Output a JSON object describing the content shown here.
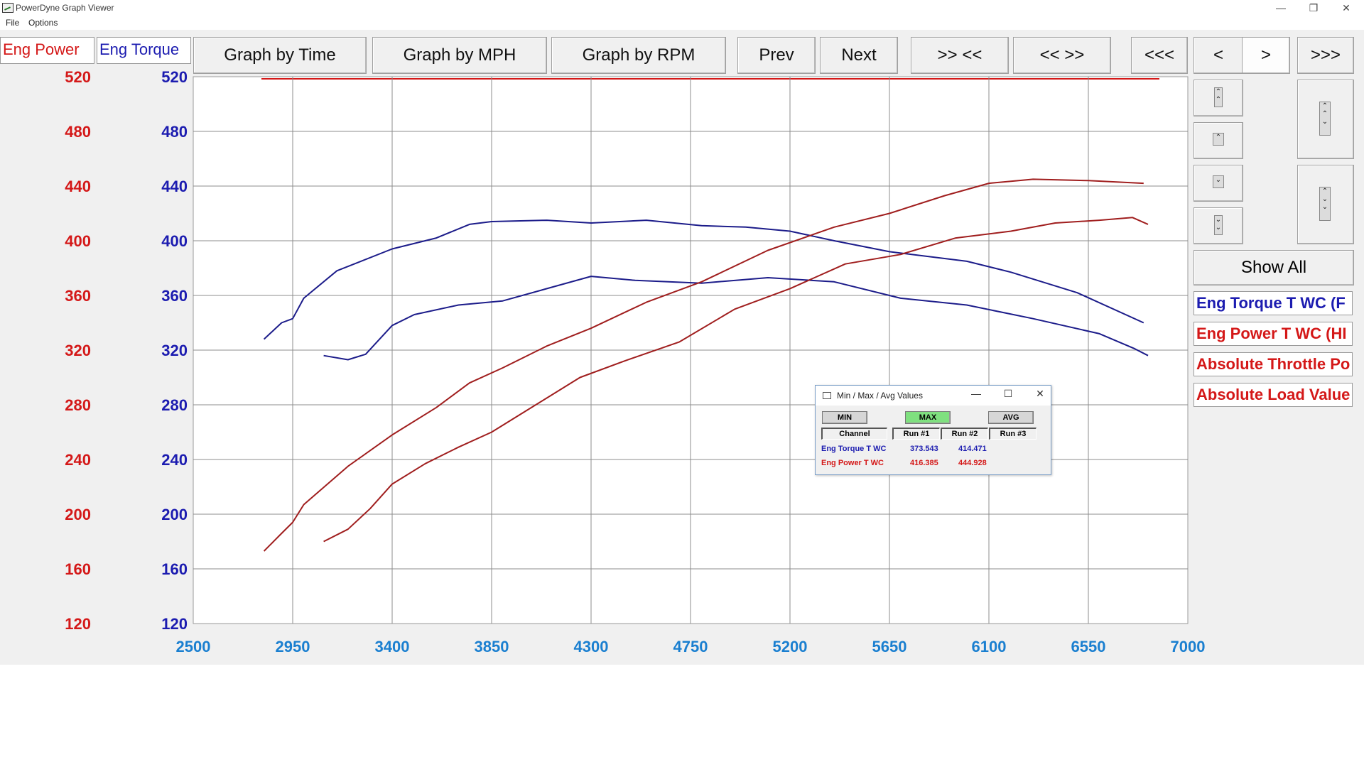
{
  "window": {
    "title": "PowerDyne Graph Viewer",
    "minimize": "—",
    "restore": "❐",
    "close": "✕"
  },
  "menu": [
    "File",
    "Options"
  ],
  "legend_tabs": {
    "power": "Eng Power",
    "torque": "Eng Torque"
  },
  "toolbar": {
    "graph_by_time": "Graph by Time",
    "graph_by_mph": "Graph by MPH",
    "graph_by_rpm": "Graph by RPM",
    "prev": "Prev",
    "next": "Next",
    "zoom_in": ">> <<",
    "zoom_out": "<< >>",
    "first": "<<<",
    "back": "<",
    "forward": ">",
    "last": ">>>"
  },
  "side": {
    "show_all": "Show All",
    "channels": [
      "Eng Torque T WC (F",
      "Eng Power T WC (HI",
      "Absolute Throttle Po",
      "Absolute Load Value"
    ],
    "channel_colors": [
      "#1c1cb0",
      "#d41818",
      "#d41818",
      "#d41818"
    ],
    "scroll_icons": [
      "double-up",
      "up",
      "down",
      "double-down"
    ]
  },
  "colors": {
    "power_axis": "#d41818",
    "torque_axis": "#1c1cb0",
    "x_axis": "#1a7fd0",
    "grid": "#8c8c8c",
    "power_line": "#a01e1e",
    "torque_line": "#1c1c8a"
  },
  "dialog": {
    "title": "Min / Max / Avg Values",
    "min": "MIN",
    "max": "MAX",
    "avg": "AVG",
    "headers": [
      "Channel",
      "Run #1",
      "Run #2",
      "Run #3"
    ],
    "rows": [
      {
        "channel": "Eng Torque T WC",
        "run1": "373.543",
        "run2": "414.471",
        "run3": "",
        "color": "#1c1cb0"
      },
      {
        "channel": "Eng Power T WC",
        "run1": "416.385",
        "run2": "444.928",
        "run3": "",
        "color": "#d41818"
      }
    ]
  },
  "chart_data": {
    "type": "line",
    "x_ticks": [
      2500,
      2950,
      3400,
      3850,
      4300,
      4750,
      5200,
      5650,
      6100,
      6550,
      7000
    ],
    "y_ticks": [
      520,
      480,
      440,
      400,
      360,
      320,
      280,
      240,
      200,
      160,
      120
    ],
    "xlim": [
      2500,
      7000
    ],
    "ylim": [
      120,
      520
    ],
    "grid": true,
    "series": [
      {
        "color": "#1c1c8a",
        "x": [
          2820,
          2900,
          2950,
          3000,
          3150,
          3400,
          3600,
          3750,
          3850,
          4100,
          4300,
          4550,
          4800,
          5000,
          5200,
          5400,
          5650,
          6000,
          6200,
          6500,
          6800
        ],
        "y": [
          328,
          340,
          343,
          358,
          378,
          394,
          402,
          412,
          414,
          415,
          413,
          415,
          411,
          410,
          407,
          400,
          392,
          385,
          377,
          362,
          340
        ]
      },
      {
        "color": "#1c1c8a",
        "x": [
          3090,
          3200,
          3280,
          3400,
          3500,
          3700,
          3900,
          4100,
          4300,
          4500,
          4800,
          5100,
          5400,
          5700,
          6000,
          6300,
          6600,
          6760,
          6820
        ],
        "y": [
          316,
          313,
          317,
          338,
          346,
          353,
          356,
          365,
          374,
          371,
          369,
          373,
          370,
          358,
          353,
          343,
          332,
          321,
          316
        ]
      },
      {
        "color": "#a01e1e",
        "x": [
          2820,
          2900,
          2950,
          3000,
          3200,
          3400,
          3600,
          3750,
          3900,
          4100,
          4300,
          4550,
          4800,
          5100,
          5400,
          5650,
          5900,
          6100,
          6300,
          6550,
          6800
        ],
        "y": [
          173,
          186,
          194,
          207,
          235,
          258,
          278,
          296,
          307,
          323,
          336,
          355,
          370,
          393,
          410,
          420,
          433,
          442,
          445,
          444,
          442
        ]
      },
      {
        "color": "#a01e1e",
        "x": [
          3090,
          3200,
          3300,
          3400,
          3550,
          3700,
          3850,
          4050,
          4250,
          4450,
          4700,
          4950,
          5200,
          5450,
          5700,
          5950,
          6200,
          6400,
          6600,
          6750,
          6820
        ],
        "y": [
          180,
          189,
          204,
          222,
          237,
          249,
          260,
          280,
          300,
          312,
          326,
          350,
          365,
          383,
          390,
          402,
          407,
          413,
          415,
          417,
          412
        ]
      }
    ]
  }
}
